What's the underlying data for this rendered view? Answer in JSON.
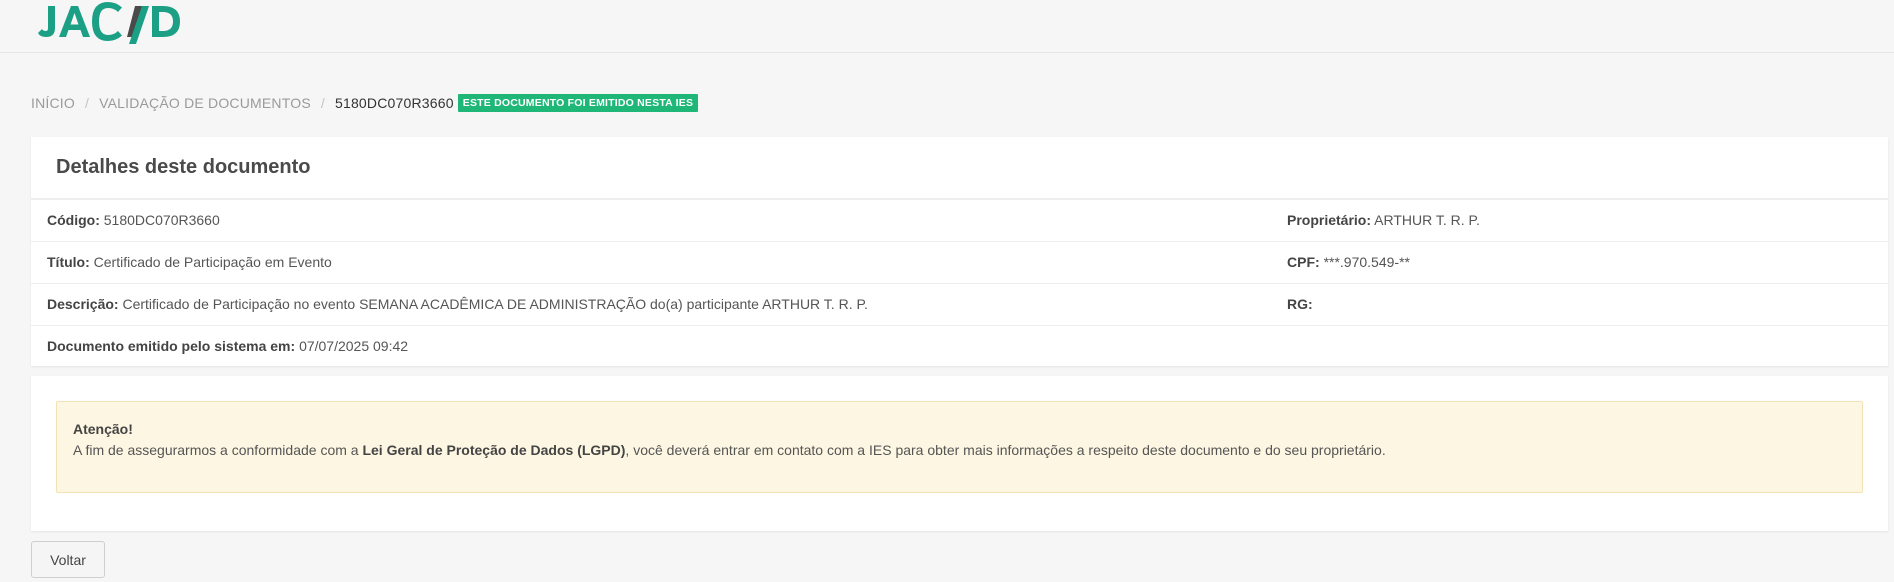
{
  "header": {
    "logo_text": "JACAD",
    "brand_color": "#1ca085"
  },
  "breadcrumb": {
    "home": "INÍCIO",
    "validation": "VALIDAÇÃO DE DOCUMENTOS",
    "current": "5180DC070R3660",
    "badge": "ESTE DOCUMENTO FOI EMITIDO NESTA IES",
    "badge_color": "#1fb777"
  },
  "details": {
    "title": "Detalhes deste documento",
    "rows": [
      {
        "left_label": "Código:",
        "left_value": "5180DC070R3660",
        "right_label": "Proprietário:",
        "right_value": "ARTHUR T. R. P."
      },
      {
        "left_label": "Título:",
        "left_value": "Certificado de Participação em Evento",
        "right_label": "CPF:",
        "right_value": "***.970.549-**"
      },
      {
        "left_label": "Descrição:",
        "left_value": "Certificado de Participação no evento SEMANA ACADÊMICA DE ADMINISTRAÇÃO do(a) participante ARTHUR T. R. P.",
        "right_label": "RG:",
        "right_value": ""
      },
      {
        "left_label": "Documento emitido pelo sistema em:",
        "left_value": "07/07/2025 09:42"
      }
    ]
  },
  "alert": {
    "title": "Atenção!",
    "text_before": "A fim de assegurarmos a conformidade com a ",
    "text_bold": "Lei Geral de Proteção de Dados (LGPD)",
    "text_after": ", você deverá entrar em contato com a IES para obter mais informações a respeito deste documento e do seu proprietário.",
    "background_color": "#fdf6e2"
  },
  "actions": {
    "back_label": "Voltar"
  }
}
